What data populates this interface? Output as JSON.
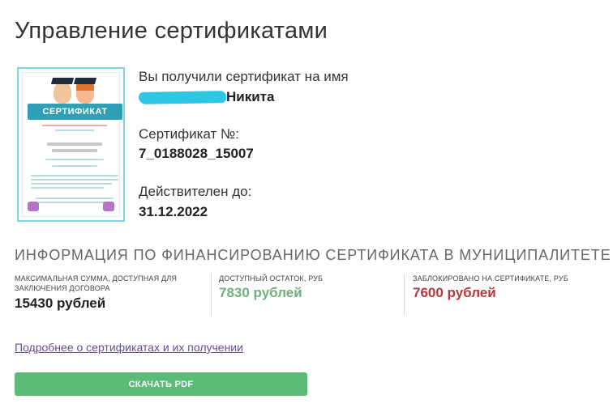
{
  "page": {
    "title": "Управление сертификатами"
  },
  "certificate": {
    "thumbnail_title": "СЕРТИФИКАТ",
    "received_label": "Вы получили сертификат на имя",
    "holder_name_visible": "Никита",
    "number_label": "Сертификат №:",
    "number_value": "7_0188028_15007",
    "valid_until_label": "Действителен до:",
    "valid_until_value": "31.12.2022"
  },
  "financing": {
    "section_title": "ИНФОРМАЦИЯ ПО ФИНАНСИРОВАНИЮ СЕРТИФИКАТА В МУНИЦИПАЛИТЕТЕ",
    "max_amount_label": "МАКСИМАЛЬНАЯ СУММА, ДОСТУПНАЯ ДЛЯ ЗАКЛЮЧЕНИЯ ДОГОВОРА",
    "max_amount_value": "15430 рублей",
    "available_label": "ДОСТУПНЫЙ ОСТАТОК, РУБ",
    "available_value": "7830 рублей",
    "blocked_label": "ЗАБЛОКИРОВАНО НА СЕРТИФИКАТЕ, РУБ",
    "blocked_value": "7600 рублей",
    "colors": {
      "available": "#6fb07a",
      "blocked": "#b0393b"
    }
  },
  "links": {
    "more_info": "Подробнее о сертификатах и их получении"
  },
  "actions": {
    "download_pdf": "СКАЧАТЬ PDF",
    "button_color": "#5cbb78"
  }
}
